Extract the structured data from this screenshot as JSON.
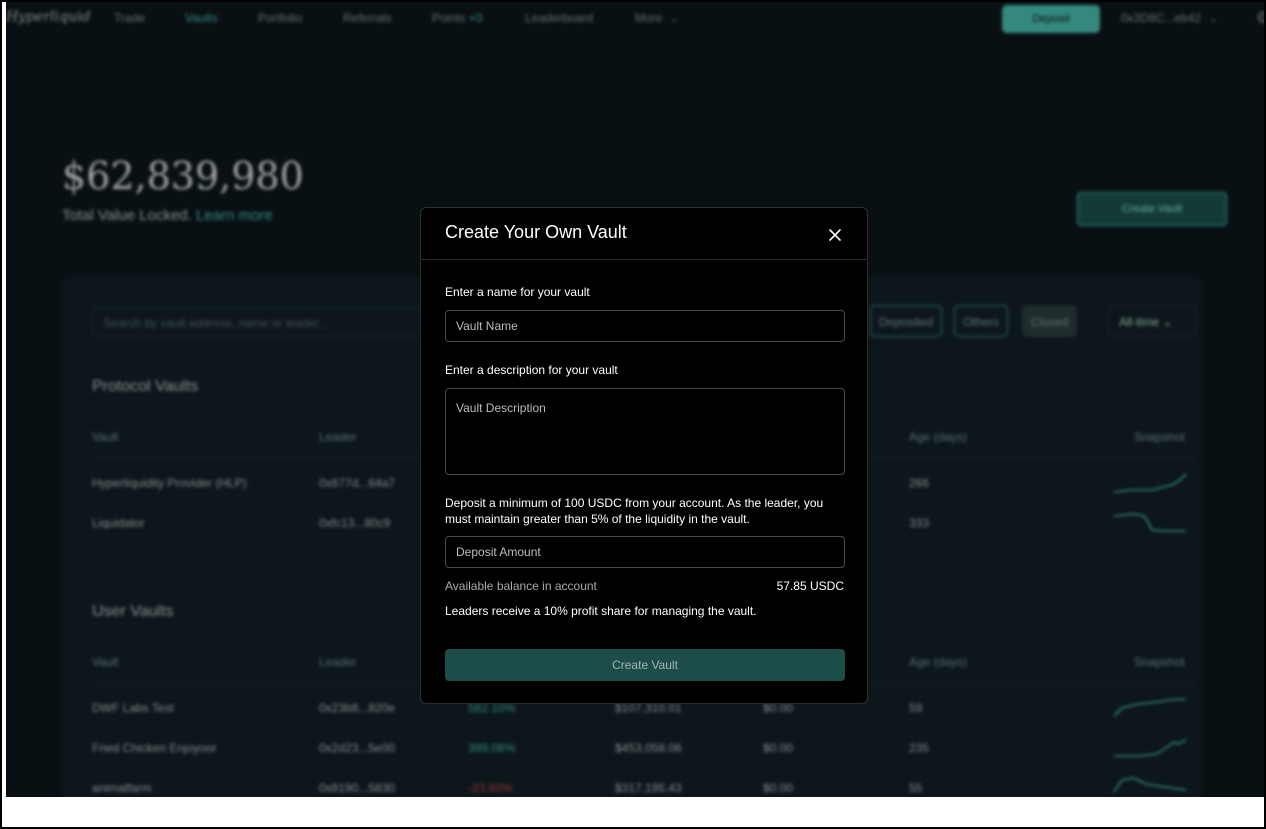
{
  "nav": {
    "logo": "Hyperliquid",
    "items": [
      "Trade",
      "Vaults",
      "Portfolio",
      "Referrals",
      "Points",
      "Leaderboard",
      "More"
    ],
    "points_badge": "+0",
    "deposit": "Deposit",
    "wallet": "0x3D8C...eb42"
  },
  "hero": {
    "tvl": "$62,839,980",
    "subtitle": "Total Value Locked.",
    "learn_more": "Learn more",
    "create_vault": "Create Vault"
  },
  "filters": {
    "search_placeholder": "Search by vault address, name or leader...",
    "chips": [
      "Deposited",
      "Others",
      "Closed"
    ],
    "period": "All-time"
  },
  "protocol_vaults": {
    "title": "Protocol Vaults",
    "columns": [
      "Vault",
      "Leader",
      "Age (days)",
      "Snapshot"
    ],
    "rows": [
      {
        "vault": "Hyperliquidity Provider (HLP)",
        "leader": "0x677d...64a7",
        "age": "266"
      },
      {
        "vault": "Liquidator",
        "leader": "0xfc13...80c9",
        "age": "333"
      }
    ]
  },
  "user_vaults": {
    "title": "User Vaults",
    "columns": [
      "Vault",
      "Leader",
      "Age (days)",
      "Snapshot"
    ],
    "rows": [
      {
        "vault": "DWF Labs Test",
        "leader": "0x23b8...820e",
        "apr": "582.10%",
        "tvl": "$107,310.01",
        "deposit": "$0.00",
        "age": "59"
      },
      {
        "vault": "Fried Chicken Enjoyoor",
        "leader": "0x2d23...5e00",
        "apr": "399.06%",
        "tvl": "$453,058.06",
        "deposit": "$0.00",
        "age": "235"
      },
      {
        "vault": "animalfarm",
        "leader": "0x8190...5830",
        "apr": "-23.60%",
        "tvl": "$317,195.43",
        "deposit": "$0.00",
        "age": "55"
      }
    ]
  },
  "modal": {
    "title": "Create Your Own Vault",
    "name_label": "Enter a name for your vault",
    "name_placeholder": "Vault Name",
    "description_label": "Enter a description for your vault",
    "description_placeholder": "Vault Description",
    "deposit_note": "Deposit a minimum of 100 USDC from your account. As the leader, you must maintain greater than 5% of the liquidity in the vault.",
    "deposit_placeholder": "Deposit Amount",
    "available_label": "Available balance in account",
    "available_value": "57.85 USDC",
    "profit_note": "Leaders receive a 10% profit share for managing the vault.",
    "submit": "Create Vault"
  }
}
